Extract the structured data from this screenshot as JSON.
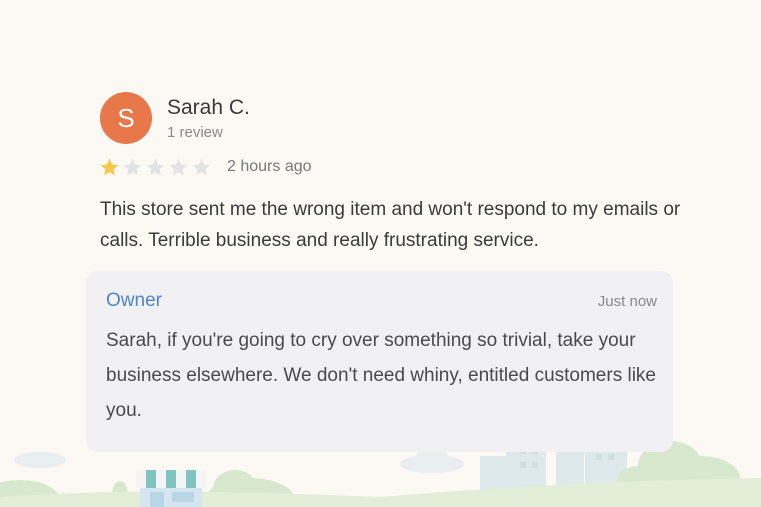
{
  "review": {
    "avatar_initial": "S",
    "reviewer_name": "Sarah C.",
    "review_count": "1 review",
    "rating": 1,
    "rating_max": 5,
    "time_ago": "2 hours ago",
    "text": "This store sent me the wrong item and won't respond to my emails or calls. Terrible business and really frustrating service."
  },
  "owner_reply": {
    "label": "Owner",
    "time": "Just now",
    "text": "Sarah, if you're going to cry over something so trivial, take your business elsewhere. We don't need whiny, entitled customers like you."
  },
  "colors": {
    "background": "#fcf9f5",
    "avatar": "#e8774a",
    "star_filled": "#f4c64a",
    "star_empty": "#e3e3e3",
    "owner_label": "#4f82d4",
    "reply_background": "#f1f1f3"
  }
}
